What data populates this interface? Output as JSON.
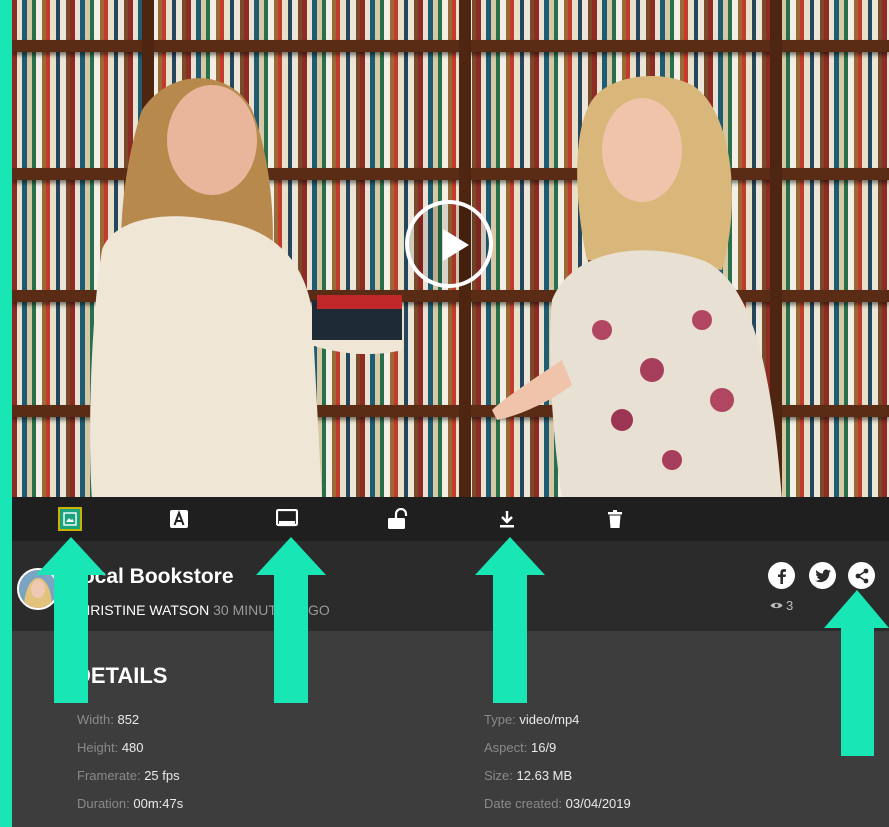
{
  "video": {
    "play_icon": "play-circle-icon"
  },
  "toolbar": {
    "buttons": [
      {
        "name": "thumbnail-icon"
      },
      {
        "name": "text-overlay-icon"
      },
      {
        "name": "screen-icon"
      },
      {
        "name": "unlock-icon"
      },
      {
        "name": "download-icon"
      },
      {
        "name": "trash-icon"
      }
    ],
    "active_color": "#1aa37d"
  },
  "info": {
    "title": "Local Bookstore",
    "author": "CHRISTINE WATSON",
    "time": "30 MINUTES AGO",
    "views": "3",
    "social": [
      "facebook-icon",
      "twitter-icon",
      "share-icon"
    ]
  },
  "details": {
    "heading": "DETAILS",
    "left": [
      {
        "key": "Width:",
        "value": "852"
      },
      {
        "key": "Height:",
        "value": "480"
      },
      {
        "key": "Framerate:",
        "value": "25 fps"
      },
      {
        "key": "Duration:",
        "value": "00m:47s"
      }
    ],
    "right": [
      {
        "key": "Type:",
        "value": "video/mp4"
      },
      {
        "key": "Aspect:",
        "value": "16/9"
      },
      {
        "key": "Size:",
        "value": "12.63 MB"
      },
      {
        "key": "Date created:",
        "value": "03/04/2019"
      }
    ]
  },
  "colors": {
    "accent": "#19e6b5",
    "toolbar": "#1f1f1f",
    "panel": "#3d3d3d"
  }
}
